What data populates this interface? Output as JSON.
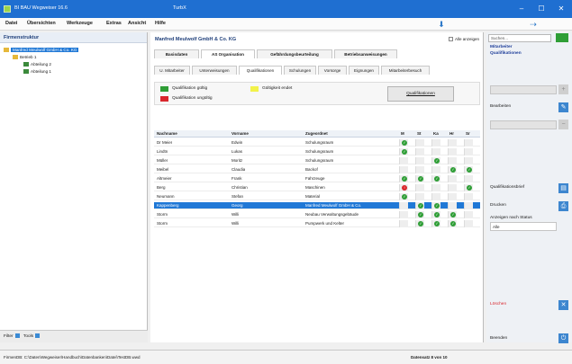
{
  "window": {
    "title": "BI BAU Wegweiser 16.6",
    "document": "TurbX",
    "controls": [
      "–",
      "☐",
      "✕"
    ]
  },
  "menu": {
    "items": [
      "Datei",
      "Übersichten",
      "Werkzeuge",
      "Extras",
      "Ansicht",
      "Hilfe"
    ]
  },
  "left": {
    "header": "Firmenstruktur",
    "tree": [
      {
        "label": "Manfred Meulwolf GmbH & Co. KG",
        "selected": true
      },
      {
        "label": "Betrieb 1",
        "selected": false
      },
      {
        "label": "Abteilung 2",
        "selected": false
      },
      {
        "label": "Abteilung 1",
        "selected": false
      }
    ],
    "footer": {
      "filter_label": "Filter",
      "tools_label": "Tools"
    }
  },
  "center": {
    "company": "Manfred Meulwolf GmbH & Co. KG",
    "show_all": "Alle anzeigen",
    "main_tabs": [
      "Basisdaten",
      "AS Organisation",
      "Gefährdungsbeurteilung",
      "Betriebsanweisungen"
    ],
    "sub_tabs": [
      "U. Mitarbeiter",
      "Unterweisungen",
      "Qualifikationen",
      "Schulungen",
      "Vorsorge",
      "Eignungen",
      "Mitarbeiterbesuch"
    ],
    "legend": {
      "valid": "Qualifikation gültig",
      "soon": "Gültigkeit endet",
      "expired": "Qualifikation ungültig",
      "button": "Qualifikationen"
    },
    "columns": [
      "Nachname",
      "Vorname",
      "Zugeordnet",
      "M",
      "St",
      "Ka",
      "Hr",
      "Sr"
    ],
    "rows": [
      {
        "last": "Dr Meier",
        "first": "Edwin",
        "assigned": "Schulungsraum",
        "marks": [
          "ok",
          "",
          "",
          "",
          ""
        ],
        "selected": false
      },
      {
        "last": "Lindtn",
        "first": "Lukas",
        "assigned": "Schulungsraum",
        "marks": [
          "ok",
          "",
          "",
          "",
          ""
        ],
        "selected": false
      },
      {
        "last": "Müller",
        "first": "Moritz",
        "assigned": "Schulungsraum",
        "marks": [
          "",
          "",
          "ok",
          "",
          ""
        ],
        "selected": false
      },
      {
        "last": "Meibel",
        "first": "Claudia",
        "assigned": "Backof",
        "marks": [
          "",
          "",
          "",
          "ok",
          "ok"
        ],
        "selected": false
      },
      {
        "last": "Altmeier",
        "first": "Frank",
        "assigned": "Fahrzeuge",
        "marks": [
          "ok",
          "ok",
          "ok",
          "",
          ""
        ],
        "selected": false
      },
      {
        "last": "Berg",
        "first": "Christian",
        "assigned": "Maschinen",
        "marks": [
          "fail",
          "",
          "",
          "",
          "ok"
        ],
        "selected": false
      },
      {
        "last": "Neumann",
        "first": "Stefan",
        "assigned": "Material",
        "marks": [
          "ok",
          "",
          "",
          "",
          ""
        ],
        "selected": false
      },
      {
        "last": "Kappenberg",
        "first": "Georg",
        "assigned": "Manfred Meulwolf GmbH & Co.",
        "marks": [
          "",
          "ok",
          "ok",
          "",
          ""
        ],
        "selected": true
      },
      {
        "last": "Storm",
        "first": "Willi",
        "assigned": "Neubau Verwaltungsgebäude",
        "marks": [
          "",
          "ok",
          "ok",
          "ok",
          ""
        ],
        "selected": false
      },
      {
        "last": "Storm",
        "first": "Willi",
        "assigned": "Pumpwerk und Kelter",
        "marks": [
          "",
          "ok",
          "ok",
          "ok",
          ""
        ],
        "selected": false
      }
    ]
  },
  "right": {
    "search": "Suchen...",
    "link1": "Mitarbeiter",
    "link2": "Qualifikationen",
    "edit": "Bearbeiten",
    "q_overview": "Qualifikationsbrief",
    "print": "Drucken",
    "filter_label": "Anzeigen nach Status",
    "filter_value": "Alle",
    "delete": "Löschen",
    "close": "Beenden"
  },
  "status": {
    "path": "FirmenDB: C:\\Daten\\Wegweiser\\Handbuch\\Datenbanken\\Datei\\TestDB.wwd",
    "count": "Datensatz 8 von 10"
  },
  "colors": {
    "accent": "#1f78d6",
    "valid": "#2f9e36",
    "soon": "#f2f24a",
    "expired": "#d9262c"
  }
}
